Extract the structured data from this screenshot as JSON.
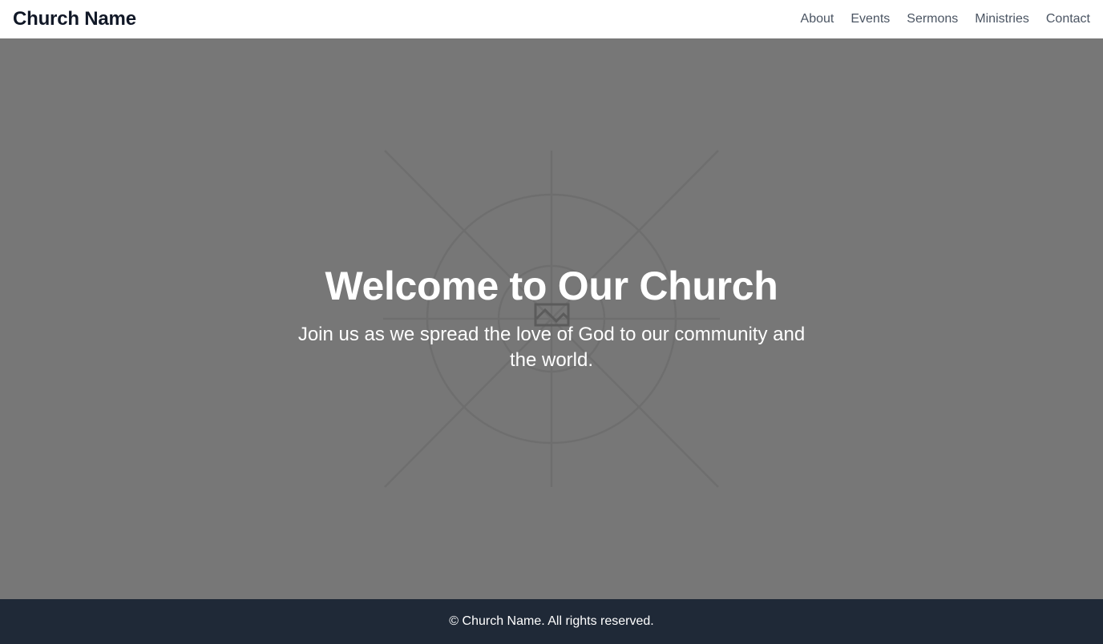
{
  "header": {
    "brand": "Church Name",
    "nav": [
      {
        "label": "About"
      },
      {
        "label": "Events"
      },
      {
        "label": "Sermons"
      },
      {
        "label": "Ministries"
      },
      {
        "label": "Contact"
      }
    ]
  },
  "hero": {
    "title": "Welcome to Our Church",
    "subtitle": "Join us as we spread the love of God to our community and the world.",
    "background_icon": "image-placeholder-icon"
  },
  "footer": {
    "text": "© Church Name. All rights reserved."
  },
  "colors": {
    "header_bg": "#ffffff",
    "hero_overlay": "#777777",
    "footer_bg": "#1f2937",
    "brand_text": "#111827",
    "nav_text": "#4b5563"
  }
}
